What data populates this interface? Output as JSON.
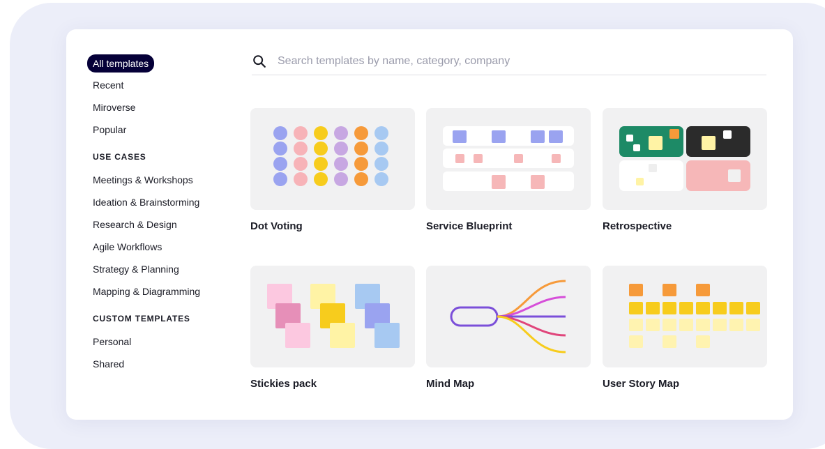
{
  "sidebar": {
    "nav": [
      {
        "label": "All templates",
        "active": true
      },
      {
        "label": "Recent",
        "active": false
      },
      {
        "label": "Miroverse",
        "active": false
      },
      {
        "label": "Popular",
        "active": false
      }
    ],
    "use_cases_title": "USE CASES",
    "use_cases": [
      "Meetings & Workshops",
      "Ideation & Brainstorming",
      "Research & Design",
      "Agile Workflows",
      "Strategy & Planning",
      "Mapping & Diagramming"
    ],
    "custom_title": "CUSTOM TEMPLATES",
    "custom": [
      "Personal",
      "Shared"
    ]
  },
  "search": {
    "placeholder": "Search templates by name, category, company",
    "value": ""
  },
  "templates": [
    {
      "title": "Dot Voting",
      "icon": "dot-voting-thumbnail"
    },
    {
      "title": "Service Blueprint",
      "icon": "service-blueprint-thumbnail"
    },
    {
      "title": "Retrospective",
      "icon": "retrospective-thumbnail"
    },
    {
      "title": "Stickies pack",
      "icon": "stickies-pack-thumbnail"
    },
    {
      "title": "Mind Map",
      "icon": "mind-map-thumbnail"
    },
    {
      "title": "User Story Map",
      "icon": "user-story-map-thumbnail"
    }
  ],
  "colors": {
    "active_pill": "#050038",
    "dot_blue": "#9aa3f0",
    "dot_pink": "#f7b3b8",
    "dot_yellow": "#f7cc1d",
    "dot_purple": "#c7a7e2",
    "dot_orange": "#f69a3a",
    "dot_lightblue": "#a7c9f2",
    "retro_green": "#1d8a66",
    "retro_dark": "#2b2b2b",
    "retro_pink": "#f6b7b8"
  }
}
